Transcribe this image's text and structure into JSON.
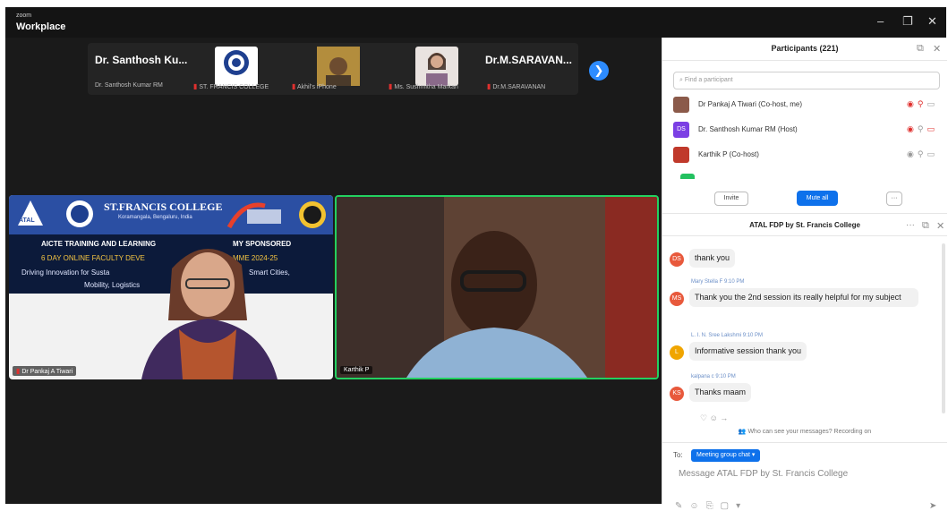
{
  "window": {
    "brand_small": "zoom",
    "brand_big": "Workplace",
    "minimize": "–",
    "restore": "❐",
    "close": "✕"
  },
  "strip": {
    "tiles": [
      {
        "name": "Dr. Santhosh Ku...",
        "sub": "Dr. Santhosh Kumar RM"
      },
      {
        "name": "",
        "sub": "ST. FRANCIS COLLEGE"
      },
      {
        "name": "",
        "sub": "Akhil's iPhone"
      },
      {
        "name": "",
        "sub": "Ms. Sushmitha Markan"
      },
      {
        "name": "Dr.M.SARAVAN...",
        "sub": "Dr.M.SARAVANAN"
      }
    ],
    "next": "❯"
  },
  "videos": {
    "left": {
      "banner_title": "ST.FRANCIS COLLEGE",
      "banner_sub": "Koramangala, Bengaluru, India",
      "atal": "ATAL",
      "line1": "AICTE TRAINING AND LEARNING",
      "line1b": "MY SPONSORED",
      "line2": "6 DAY ONLINE FACULTY DEVE",
      "line2b": "MME 2024-25",
      "line3": "Driving Innovation for Susta",
      "line3b": "Smart Cities,",
      "line4": "Mobility, Logistics",
      "name": "Dr Pankaj A Tiwari"
    },
    "right": {
      "name": "Karthik P"
    }
  },
  "participants": {
    "title": "Participants (221)",
    "search_placeholder": "Find a participant",
    "rows": [
      {
        "initials": "",
        "name": "Dr Pankaj A Tiwari (Co-host, me)",
        "color": "#8b5a4a"
      },
      {
        "initials": "DS",
        "name": "Dr. Santhosh Kumar RM (Host)",
        "color": "#7b3fe4"
      },
      {
        "initials": "",
        "name": "Karthik P (Co-host)",
        "color": "#c0392b"
      }
    ],
    "invite": "Invite",
    "mute_all": "Mute all",
    "more": "···"
  },
  "chat": {
    "title": "ATAL FDP by St. Francis College",
    "messages": [
      {
        "initials": "DS",
        "color": "#e8593c",
        "sender": "",
        "text": "thank you"
      },
      {
        "initials": "MS",
        "color": "#e8593c",
        "sender": "Mary Stella F 9:10 PM",
        "text": "Thank you the 2nd session its really helpful for my subject"
      },
      {
        "initials": "L",
        "color": "#f0a500",
        "sender": "L. I. N. Sree Lakshmi 9:10 PM",
        "text": "Informative session thank you"
      },
      {
        "initials": "KS",
        "color": "#e8593c",
        "sender": "kalpana c 9:10 PM",
        "text": "Thanks maam"
      }
    ],
    "notice": "Who can see your messages? Recording on",
    "to_label": "To:",
    "to_target": "Meeting group chat ▾",
    "compose_placeholder": "Message ATAL FDP by St. Francis College"
  }
}
